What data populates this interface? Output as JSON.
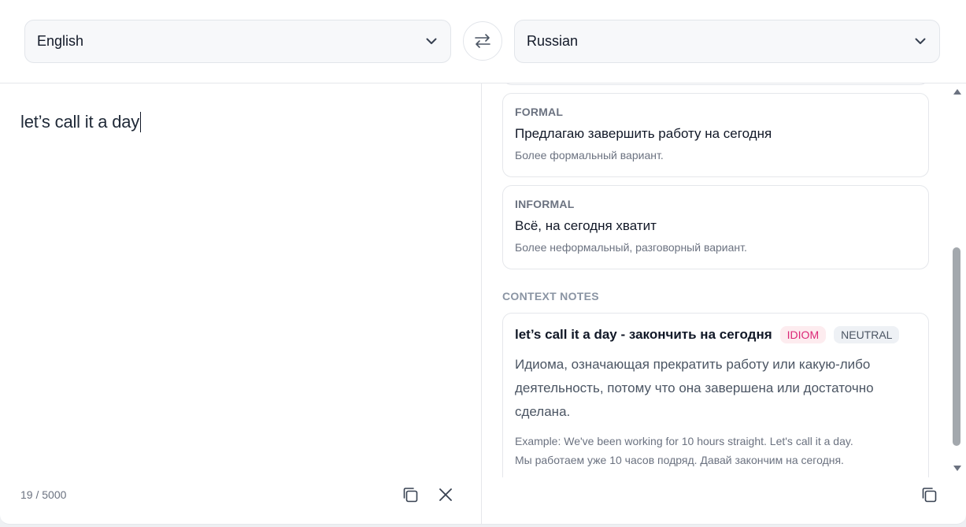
{
  "source_language": {
    "label": "English"
  },
  "target_language": {
    "label": "Russian"
  },
  "swap": {
    "icon": "swap-arrows-icon"
  },
  "source": {
    "text": "let’s call it a day",
    "char_count": "19 / 5000"
  },
  "variants": [
    {
      "kind": "FORMAL",
      "text": "Предлагаю завершить работу на сегодня",
      "description": "Более формальный вариант."
    },
    {
      "kind": "INFORMAL",
      "text": "Всё, на сегодня хватит",
      "description": "Более неформальный, разговорный вариант."
    }
  ],
  "context": {
    "section_title": "CONTEXT NOTES",
    "note": {
      "title": "let’s call it a day - закончить на сегодня",
      "badges": [
        "IDIOM",
        "NEUTRAL"
      ],
      "body": "Идиома, означающая прекратить работу или какую-либо деятельность, потому что она завершена или достаточно сделана.",
      "example_en": "Example: We've been working for 10 hours straight. Let's call it a day.",
      "example_ru": "Мы работаем уже 10 часов подряд. Давай закончим на сегодня."
    }
  },
  "colors": {
    "badge_idiom": "#db2777",
    "badge_idiom_bg": "#fdecef",
    "badge_neutral_bg": "#eef1f5",
    "border": "#e5e7eb"
  }
}
